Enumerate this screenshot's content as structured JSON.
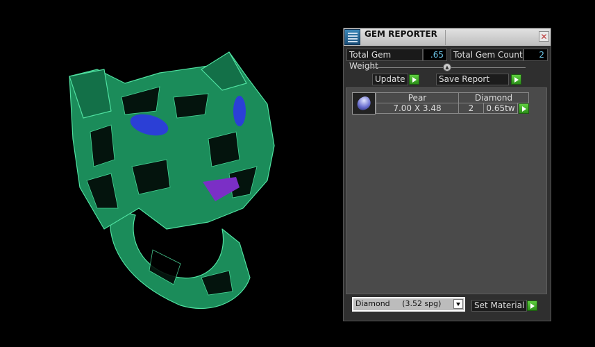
{
  "window": {
    "title": "GEM REPORTER",
    "close_icon": "close-icon"
  },
  "stats": {
    "weight_label": "Total Gem Weight",
    "weight_value": ".65",
    "count_label": "Total Gem Count",
    "count_value": "2"
  },
  "buttons": {
    "update": "Update",
    "save_report": "Save Report",
    "set_material": "Set Material"
  },
  "gems": [
    {
      "shape": "Pear",
      "size": "7.00 X 3.48",
      "material": "Diamond",
      "count": "2",
      "weight": "0.65tw"
    }
  ],
  "material_select": {
    "value": "Diamond",
    "spg": "(3.52 spg)"
  },
  "colors": {
    "model": "#1f9a63",
    "panel": "#2f2f2f",
    "list": "#4a4a4a",
    "value_text": "#6cc6e8"
  }
}
